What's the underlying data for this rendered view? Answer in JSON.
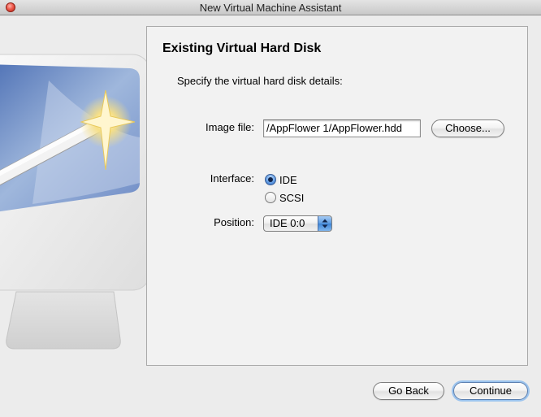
{
  "window": {
    "title": "New Virtual Machine Assistant"
  },
  "panel": {
    "title": "Existing Virtual Hard Disk",
    "subtitle": "Specify the virtual hard disk details:"
  },
  "image_file": {
    "label": "Image file:",
    "value": "/AppFlower 1/AppFlower.hdd",
    "choose_label": "Choose..."
  },
  "interface": {
    "label": "Interface:",
    "options": [
      {
        "label": "IDE",
        "selected": true
      },
      {
        "label": "SCSI",
        "selected": false
      }
    ]
  },
  "position": {
    "label": "Position:",
    "value": "IDE 0:0"
  },
  "footer": {
    "go_back_label": "Go Back",
    "continue_label": "Continue"
  },
  "icons": {
    "close": "close-icon",
    "illustration": "computer-wand-illustration",
    "popup_arrows": "up-down-arrows-icon"
  },
  "colors": {
    "accent_blue": "#3e84d6",
    "close_red": "#ee5a4c"
  }
}
